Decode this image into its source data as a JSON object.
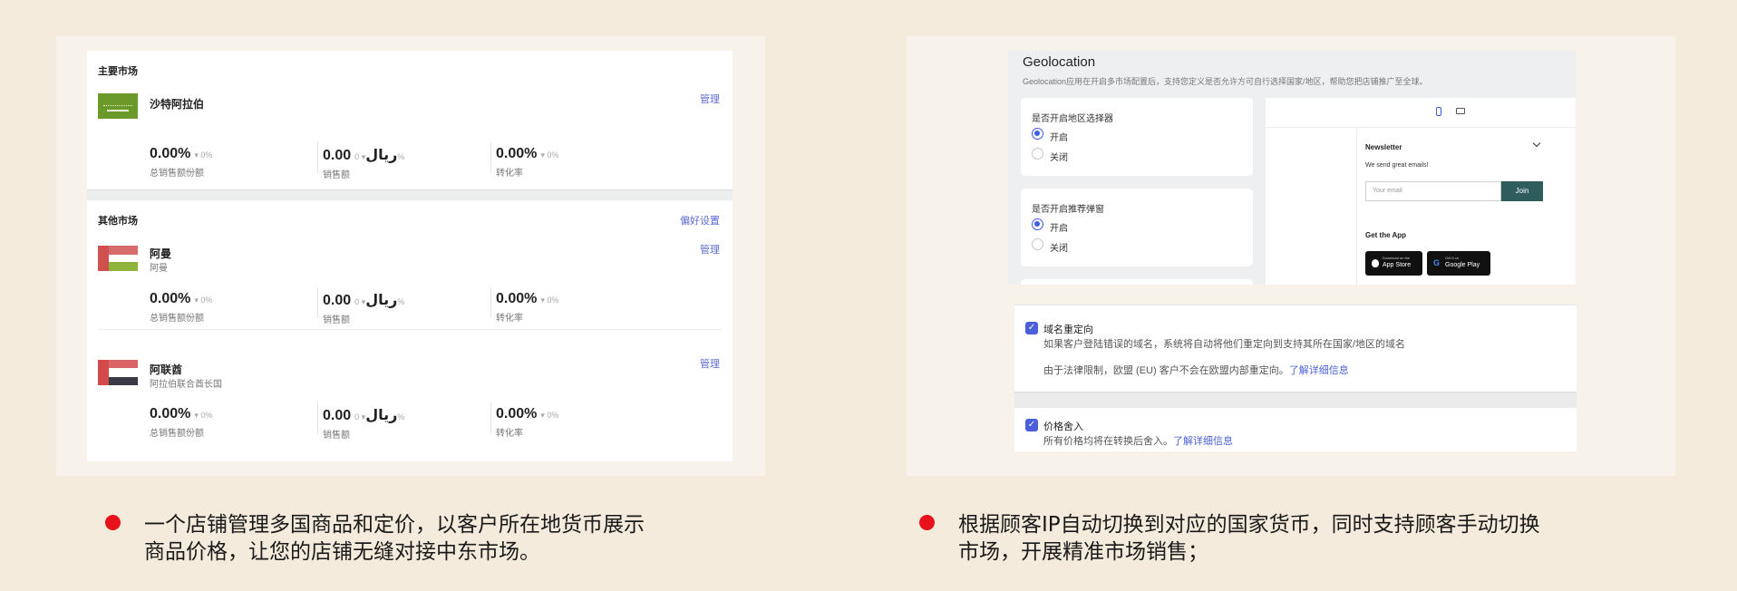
{
  "left_panel": {
    "primary": {
      "title": "主要市场",
      "market": {
        "name": "沙特阿拉伯",
        "manage": "管理",
        "flag_text": "لا إله إلا الله",
        "metrics": [
          {
            "value": "0.00%",
            "delta": "0%",
            "label": "总销售额份额"
          },
          {
            "value": "0.00ريال",
            "delta": "0%",
            "label": "销售额"
          },
          {
            "value": "0.00%",
            "delta": "0%",
            "label": "转化率"
          }
        ]
      }
    },
    "others": {
      "title": "其他市场",
      "prefs": "偏好设置",
      "markets": [
        {
          "name": "阿曼",
          "sub": "阿曼",
          "manage": "管理",
          "metrics": [
            {
              "value": "0.00%",
              "delta": "0%",
              "label": "总销售额份额"
            },
            {
              "value": "0.00ريال",
              "delta": "0%",
              "label": "销售额"
            },
            {
              "value": "0.00%",
              "delta": "0%",
              "label": "转化率"
            }
          ]
        },
        {
          "name": "阿联酋",
          "sub": "阿拉伯联合酋长国",
          "manage": "管理",
          "metrics": [
            {
              "value": "0.00%",
              "delta": "0%",
              "label": "总销售额份额"
            },
            {
              "value": "0.00ريال",
              "delta": "0%",
              "label": "销售额"
            },
            {
              "value": "0.00%",
              "delta": "0%",
              "label": "转化率"
            }
          ]
        }
      ]
    }
  },
  "right_panel": {
    "title": "Geolocation",
    "desc": "Geolocation应用在开启多市场配置后，支持您定义是否允许方可自行选择国家/地区，帮助您把店铺推广至全球。",
    "selector": {
      "question": "是否开启地区选择器",
      "on": "开启",
      "off": "关闭"
    },
    "popup": {
      "question": "是否开启推荐弹窗",
      "on": "开启",
      "off": "关闭"
    },
    "preview": {
      "newsletter": "Newsletter",
      "tagline": "We send great emails!",
      "email_placeholder": "Your email",
      "join": "Join",
      "get_app": "Get the App",
      "app_store_small": "Download on the",
      "app_store": "App Store",
      "google_play_small": "Get it on",
      "google_play": "Google Play"
    },
    "redirect": {
      "title": "域名重定向",
      "desc": "如果客户登陆错误的域名，系统将自动将他们重定向到支持其所在国家/地区的域名",
      "note": "由于法律限制，欧盟 (EU) 客户不会在欧盟内部重定向。",
      "link": "了解详细信息"
    },
    "rounding": {
      "title": "价格舍入",
      "desc": "所有价格均将在转换后舍入。",
      "link": "了解详细信息"
    }
  },
  "captions": {
    "left": [
      "一个店铺管理多国商品和定价，以客户所在地货币展示",
      "商品价格，让您的店铺无缝对接中东市场。"
    ],
    "right": [
      "根据顾客IP自动切换到对应的国家货币，同时支持顾客手动切换",
      "市场，开展精准市场销售；"
    ]
  },
  "colors": {
    "background": "#f4ebdc",
    "link": "#5b6ad1",
    "accent": "#3e5ee6",
    "bullet": "#e8121c",
    "join": "#2e5d5b",
    "saudi_green": "#6b9a2a",
    "oman_red": "#d05050",
    "oman_green": "#8fb43b",
    "uae_red": "#d44a4a",
    "uae_black": "#3a3a46"
  }
}
